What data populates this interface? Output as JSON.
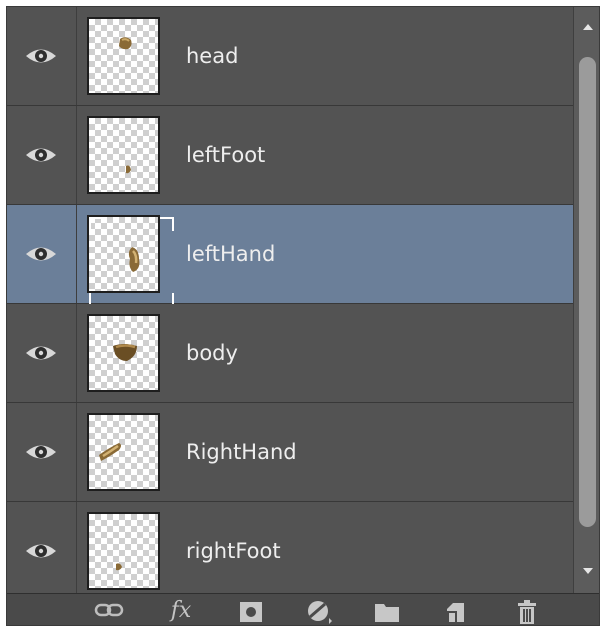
{
  "layers": [
    {
      "name": "head",
      "visible": true,
      "selected": false,
      "thumb_icon": "head-sprite-icon"
    },
    {
      "name": "leftFoot",
      "visible": true,
      "selected": false,
      "thumb_icon": "left-foot-sprite-icon"
    },
    {
      "name": "leftHand",
      "visible": true,
      "selected": true,
      "thumb_icon": "left-hand-sprite-icon"
    },
    {
      "name": "body",
      "visible": true,
      "selected": false,
      "thumb_icon": "body-sprite-icon"
    },
    {
      "name": "RightHand",
      "visible": true,
      "selected": false,
      "thumb_icon": "right-hand-sprite-icon"
    },
    {
      "name": "rightFoot",
      "visible": true,
      "selected": false,
      "thumb_icon": "right-foot-sprite-icon"
    }
  ],
  "toolbar": {
    "icons": [
      "link-layers-icon",
      "fx-icon",
      "layer-mask-icon",
      "adjustment-layer-icon",
      "folder-icon",
      "new-layer-icon",
      "trash-icon"
    ],
    "fx_label": "fx"
  },
  "colors": {
    "panel_bg": "#535353",
    "selected_row": "#6b7f99",
    "text": "#eeeeee",
    "scroll_thumb": "#9b9b9b"
  }
}
